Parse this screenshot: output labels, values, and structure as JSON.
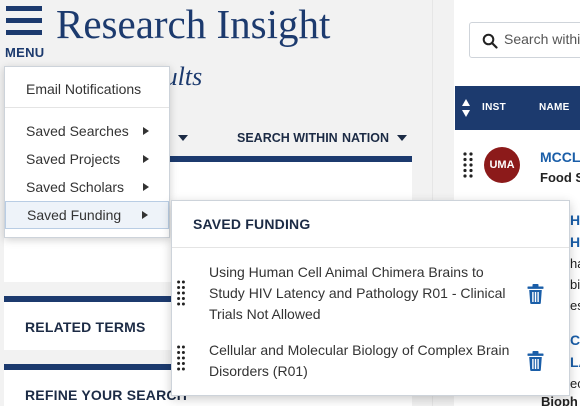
{
  "header": {
    "menu_label": "MENU",
    "brand_title": "Research Insight",
    "subtitle_visible": "esults"
  },
  "filters": {
    "search_within": "SEARCH WITHIN",
    "nation": "NATION"
  },
  "sidebar_cards": {
    "related_terms": "RELATED TERMS",
    "refine_search": "REFINE YOUR SEARCH"
  },
  "menu": {
    "items": [
      {
        "label": "Email Notifications",
        "has_submenu": false
      },
      {
        "label": "Saved Searches",
        "has_submenu": true
      },
      {
        "label": "Saved Projects",
        "has_submenu": true
      },
      {
        "label": "Saved Scholars",
        "has_submenu": true
      },
      {
        "label": "Saved Funding",
        "has_submenu": true,
        "active": true
      }
    ]
  },
  "saved_funding": {
    "title": "SAVED FUNDING",
    "items": [
      {
        "title": "Using Human Cell Animal Chimera Brains to Study HIV Latency and Pathology R01 - Clinical Trials Not Allowed"
      },
      {
        "title": "Cellular and Molecular Biology of Complex Brain Disorders (R01)"
      }
    ]
  },
  "right_panel": {
    "search_placeholder": "Search within",
    "columns": {
      "inst": "INST",
      "name": "NAME"
    },
    "row1": {
      "avatar": "UMA",
      "name": "MCCL",
      "sub": "Food S"
    },
    "bleed": [
      "HA",
      "HC",
      "ha",
      "bi",
      "es",
      "CA",
      "LA",
      "ec",
      "Bioph"
    ]
  },
  "colors": {
    "navy": "#1c3a6e",
    "link_blue": "#1a5ea8",
    "avatar_red": "#8c1a1a",
    "icon_blue": "#1a5ea8"
  }
}
